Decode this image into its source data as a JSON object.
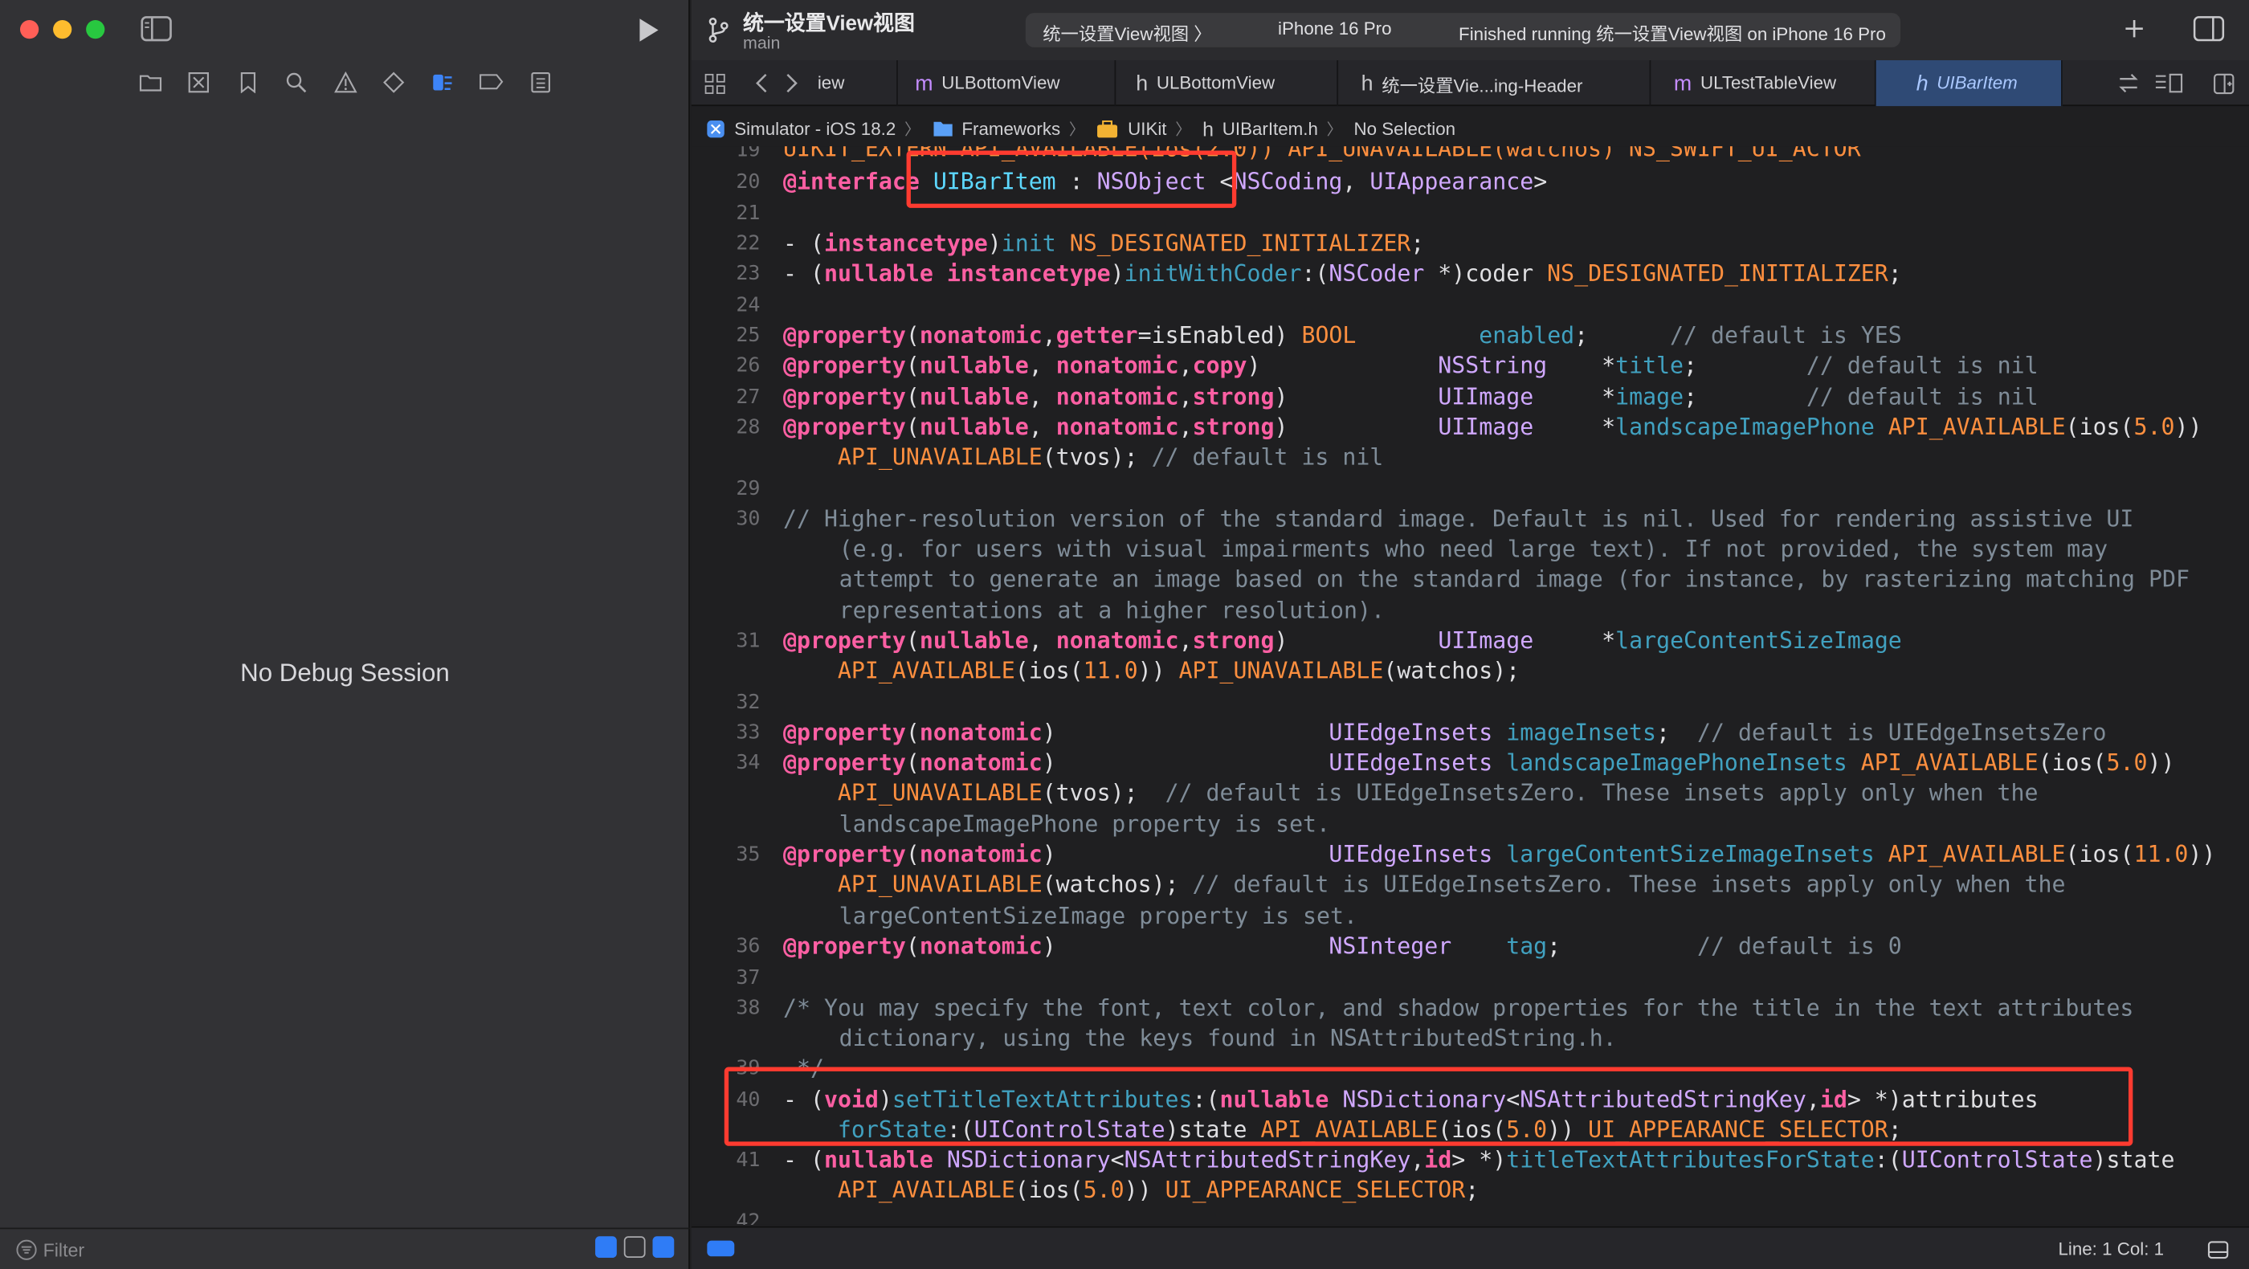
{
  "left_panel": {
    "no_debug_text": "No Debug Session",
    "filter_placeholder": "Filter"
  },
  "toolbar": {
    "project_title": "统一设置View视图",
    "branch": "main",
    "scheme_app": "统一设置View视图 〉",
    "scheme_device": "iPhone 16 Pro",
    "scheme_status": "Finished running 统一设置View视图 on iPhone 16 Pro"
  },
  "tabs": [
    {
      "kind": "",
      "label": "iew"
    },
    {
      "kind": "m",
      "label": "ULBottomView"
    },
    {
      "kind": "h",
      "label": "ULBottomView"
    },
    {
      "kind": "h",
      "label": "统一设置Vie...ing-Header"
    },
    {
      "kind": "m",
      "label": "ULTestTableView"
    },
    {
      "kind": "h",
      "label": "UIBarItem"
    }
  ],
  "breadcrumb": [
    {
      "icon": "xcodeproj-icon",
      "label": "Simulator - iOS 18.2"
    },
    {
      "icon": "folder-icon",
      "label": "Frameworks"
    },
    {
      "icon": "toolbox-icon",
      "label": "UIKit"
    },
    {
      "icon": "h",
      "label": "UIBarItem.h"
    },
    {
      "icon": "",
      "label": "No Selection"
    }
  ],
  "code_lines": {
    "l19": "UIKIT_EXTERN API_AVAILABLE(ios(2.0)) API_UNAVAILABLE(watchos) NS_SWIFT_UI_ACTOR",
    "l20": "@interface UIBarItem : NSObject <NSCoding, UIAppearance>",
    "l22": "- (instancetype)init NS_DESIGNATED_INITIALIZER;",
    "l23": "- (nullable instancetype)initWithCoder:(NSCoder *)coder NS_DESIGNATED_INITIALIZER;",
    "l30_1": "// Higher-resolution version of the standard image. Default is nil. Used for rendering assistive UI",
    "l30_2": "(e.g. for users with visual impairments who need large text). If not provided, the system may",
    "l30_3": "attempt to generate an image based on the standard image (for instance, by rasterizing matching PDF",
    "l30_4": "representations at a higher resolution).",
    "l38_1": "/* You may specify the font, text color, and shadow properties for the title in the text attributes",
    "l38_2": "dictionary, using the keys found in NSAttributedString.h.",
    "l39": " */"
  },
  "line_numbers": [
    "19",
    "20",
    "21",
    "22",
    "23",
    "24",
    "25",
    "26",
    "27",
    "28",
    "29",
    "30",
    "31",
    "32",
    "33",
    "34",
    "35",
    "36",
    "37",
    "38",
    "39",
    "40",
    "41",
    "42"
  ],
  "status": {
    "position": "Line: 1  Col: 1"
  },
  "colors": {
    "keyword": "#fc5fa3",
    "type": "#d0a8ff",
    "method": "#41a1c0",
    "macro": "#fd8f3f",
    "comment": "#7f8c98",
    "highlight": "#ff3b30"
  }
}
